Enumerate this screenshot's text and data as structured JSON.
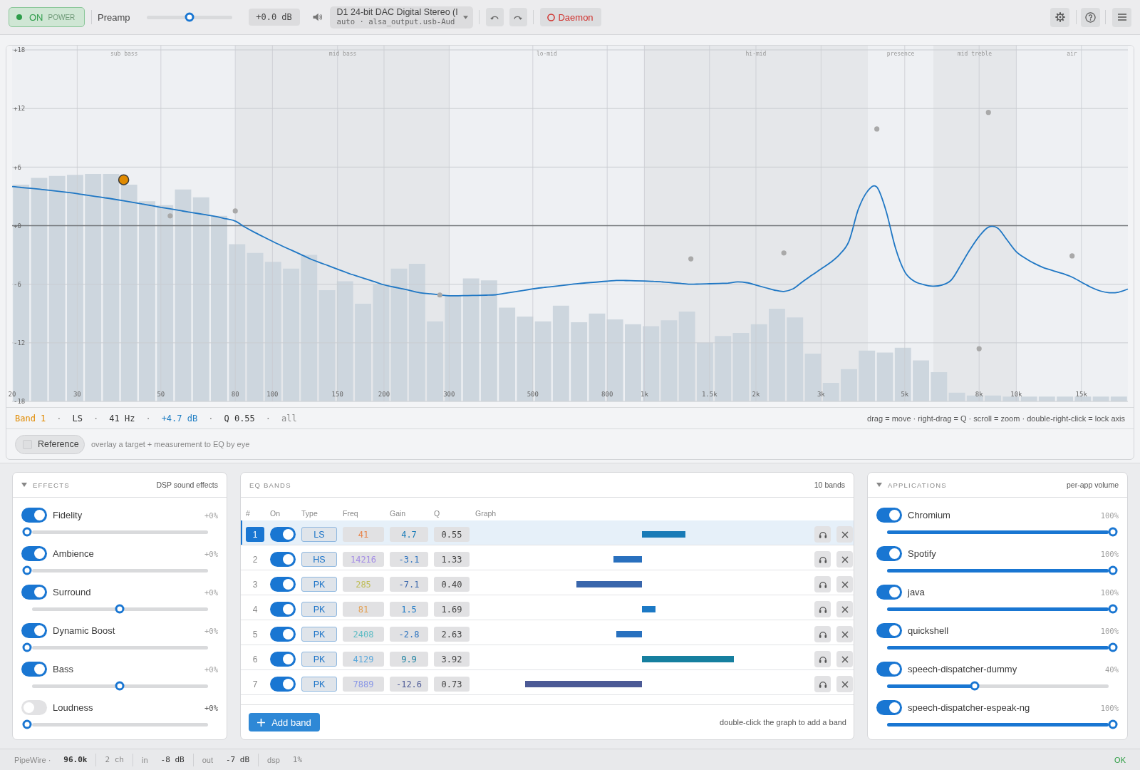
{
  "topbar": {
    "power": {
      "on": true,
      "label": "ON",
      "caption": "POWER"
    },
    "preamp": {
      "label": "Preamp",
      "level": 0.5,
      "reading": "+0.0 dB"
    },
    "device": {
      "name": "D1 24-bit DAC Digital Stereo (I",
      "detail": "auto · alsa_output.usb-Aud"
    },
    "daemon": {
      "label": "Daemon",
      "running": false
    }
  },
  "graph": {
    "zones": [
      "sub bass",
      "mid bass",
      "lo-mid",
      "hi-mid",
      "presence",
      "mid treble",
      "air"
    ],
    "chart_data": {
      "type": "line",
      "grid": true,
      "ylim": [
        -18,
        18
      ],
      "yticks": [
        {
          "value": 18,
          "label": "+18"
        },
        {
          "value": 12,
          "label": "+12"
        },
        {
          "value": 6,
          "label": "+6"
        },
        {
          "value": 0,
          "label": "+0"
        },
        {
          "value": -6,
          "label": "-6"
        },
        {
          "value": -12,
          "label": "-12"
        },
        {
          "value": -18,
          "label": "-18"
        }
      ],
      "categories": [
        "20",
        null,
        null,
        null,
        null,
        null,
        null,
        "30",
        null,
        null,
        null,
        null,
        null,
        null,
        null,
        null,
        "50",
        null,
        null,
        null,
        null,
        null,
        null,
        null,
        "80",
        null,
        null,
        null,
        "100",
        null,
        null,
        null,
        null,
        null,
        null,
        "150",
        null,
        null,
        null,
        null,
        "200",
        null,
        null,
        null,
        null,
        null,
        null,
        "300",
        null,
        null,
        null,
        null,
        null,
        null,
        null,
        null,
        "500",
        null,
        null,
        null,
        null,
        null,
        null,
        null,
        "800",
        null,
        null,
        null,
        "1k",
        null,
        null,
        null,
        null,
        null,
        null,
        "1.5k",
        null,
        null,
        null,
        null,
        "2k",
        null,
        null,
        null,
        null,
        null,
        null,
        "3k",
        null,
        null,
        null,
        null,
        null,
        null,
        null,
        null,
        "5k",
        null,
        null,
        null,
        null,
        null,
        null,
        null,
        "8k",
        null,
        null,
        null,
        "10k",
        null,
        null,
        null,
        null,
        null,
        null,
        "15k",
        null,
        null,
        null,
        null,
        null
      ],
      "series": [
        {
          "color": "#1f77c4",
          "values": [
            4.0,
            3.91,
            3.82,
            3.73,
            3.63,
            3.52,
            3.41,
            3.28,
            3.13,
            2.99,
            2.85,
            2.7,
            2.55,
            2.39,
            2.22,
            2.05,
            1.88,
            1.72,
            1.56,
            1.4,
            1.24,
            1.08,
            0.92,
            0.7,
            0.47,
            -0.13,
            -0.65,
            -1.13,
            -1.61,
            -2.06,
            -2.5,
            -2.93,
            -3.37,
            -3.75,
            -4.1,
            -4.46,
            -4.82,
            -5.14,
            -5.45,
            -5.75,
            -6.06,
            -6.28,
            -6.48,
            -6.69,
            -6.89,
            -6.99,
            -7.09,
            -7.18,
            -7.18,
            -7.16,
            -7.14,
            -7.12,
            -7.08,
            -6.93,
            -6.78,
            -6.63,
            -6.48,
            -6.35,
            -6.25,
            -6.14,
            -6.03,
            -5.93,
            -5.84,
            -5.77,
            -5.69,
            -5.61,
            -5.62,
            -5.65,
            -5.67,
            -5.7,
            -5.77,
            -5.85,
            -5.92,
            -6.0,
            -5.97,
            -5.95,
            -5.92,
            -5.89,
            -5.76,
            -5.84,
            -6.09,
            -6.35,
            -6.61,
            -6.74,
            -6.46,
            -5.75,
            -5.08,
            -4.44,
            -3.78,
            -2.94,
            -1.6,
            1.65,
            3.53,
            3.95,
            1.48,
            -2.28,
            -4.72,
            -5.68,
            -6.03,
            -6.2,
            -6.09,
            -5.58,
            -4.08,
            -2.49,
            -1.1,
            -0.15,
            -0.25,
            -1.46,
            -2.67,
            -3.35,
            -3.9,
            -4.33,
            -4.62,
            -4.91,
            -5.27,
            -5.78,
            -6.3,
            -6.68,
            -6.87,
            -6.81,
            -6.5
          ]
        },
        {
          "color": "#e08a00",
          "marker": "o",
          "values": [
            null,
            null,
            null,
            null,
            null,
            null,
            null,
            null,
            null,
            null,
            null,
            null,
            4.7,
            null,
            null,
            null,
            null,
            null,
            null,
            null,
            null,
            null,
            null,
            null,
            null,
            null,
            null,
            null,
            null,
            null,
            null,
            null,
            null,
            null,
            null,
            null,
            null,
            null,
            null,
            null,
            null,
            null,
            null,
            null,
            null,
            null,
            null,
            null,
            null,
            null,
            null,
            null,
            null,
            null,
            null,
            null,
            null,
            null,
            null,
            null,
            null,
            null,
            null,
            null,
            null,
            null,
            null,
            null,
            null,
            null,
            null,
            null,
            null,
            null,
            null,
            null,
            null,
            null,
            null,
            null,
            null,
            null,
            null,
            null,
            null,
            null,
            null,
            null,
            null,
            null,
            null,
            null,
            null,
            null,
            null,
            null,
            null,
            null,
            null,
            null,
            null,
            null,
            null,
            null,
            null,
            null,
            null,
            null,
            null,
            null,
            null,
            null,
            null,
            null,
            null,
            null,
            null,
            null,
            null,
            null,
            null
          ]
        },
        {
          "color": "#a9a9a9",
          "marker": "o",
          "values": [
            null,
            null,
            null,
            null,
            null,
            null,
            null,
            null,
            null,
            null,
            null,
            null,
            null,
            null,
            null,
            null,
            null,
            null,
            null,
            null,
            null,
            null,
            null,
            null,
            null,
            null,
            null,
            null,
            null,
            null,
            null,
            null,
            null,
            null,
            null,
            null,
            null,
            null,
            null,
            null,
            null,
            null,
            null,
            null,
            null,
            null,
            null,
            null,
            null,
            null,
            null,
            null,
            null,
            null,
            null,
            null,
            null,
            null,
            null,
            null,
            null,
            null,
            null,
            null,
            null,
            null,
            null,
            null,
            null,
            null,
            null,
            null,
            null,
            null,
            null,
            null,
            null,
            null,
            null,
            null,
            null,
            null,
            null,
            null,
            null,
            null,
            null,
            null,
            null,
            null,
            null,
            null,
            null,
            null,
            null,
            null,
            null,
            null,
            null,
            null,
            null,
            null,
            null,
            null,
            null,
            null,
            null,
            null,
            null,
            null,
            null,
            null,
            null,
            null,
            -3.1,
            null,
            null,
            null,
            null,
            null,
            null
          ]
        },
        {
          "color": "#a9a9a9",
          "marker": "o",
          "values": [
            null,
            null,
            null,
            null,
            null,
            null,
            null,
            null,
            null,
            null,
            null,
            null,
            null,
            null,
            null,
            null,
            null,
            null,
            null,
            null,
            null,
            null,
            null,
            null,
            null,
            null,
            null,
            null,
            null,
            null,
            null,
            null,
            null,
            null,
            null,
            null,
            null,
            null,
            null,
            null,
            null,
            null,
            null,
            null,
            null,
            null,
            -7.1,
            null,
            null,
            null,
            null,
            null,
            null,
            null,
            null,
            null,
            null,
            null,
            null,
            null,
            null,
            null,
            null,
            null,
            null,
            null,
            null,
            null,
            null,
            null,
            null,
            null,
            null,
            null,
            null,
            null,
            null,
            null,
            null,
            null,
            null,
            null,
            null,
            null,
            null,
            null,
            null,
            null,
            null,
            null,
            null,
            null,
            null,
            null,
            null,
            null,
            null,
            null,
            null,
            null,
            null,
            null,
            null,
            null,
            null,
            null,
            null,
            null,
            null,
            null,
            null,
            null,
            null,
            null,
            null,
            null,
            null,
            null,
            null,
            null,
            null
          ]
        },
        {
          "color": "#a9a9a9",
          "marker": "o",
          "values": [
            null,
            null,
            null,
            null,
            null,
            null,
            null,
            null,
            null,
            null,
            null,
            null,
            null,
            null,
            null,
            null,
            null,
            null,
            null,
            null,
            null,
            null,
            null,
            null,
            1.5,
            null,
            null,
            null,
            null,
            null,
            null,
            null,
            null,
            null,
            null,
            null,
            null,
            null,
            null,
            null,
            null,
            null,
            null,
            null,
            null,
            null,
            null,
            null,
            null,
            null,
            null,
            null,
            null,
            null,
            null,
            null,
            null,
            null,
            null,
            null,
            null,
            null,
            null,
            null,
            null,
            null,
            null,
            null,
            null,
            null,
            null,
            null,
            null,
            null,
            null,
            null,
            null,
            null,
            null,
            null,
            null,
            null,
            null,
            null,
            null,
            null,
            null,
            null,
            null,
            null,
            null,
            null,
            null,
            null,
            null,
            null,
            null,
            null,
            null,
            null,
            null,
            null,
            null,
            null,
            null,
            null,
            null,
            null,
            null,
            null,
            null,
            null,
            null,
            null,
            null,
            null,
            null,
            null,
            null,
            null,
            null
          ]
        },
        {
          "color": "#a9a9a9",
          "marker": "o",
          "values": [
            null,
            null,
            null,
            null,
            null,
            null,
            null,
            null,
            null,
            null,
            null,
            null,
            null,
            null,
            null,
            null,
            null,
            null,
            null,
            null,
            null,
            null,
            null,
            null,
            null,
            null,
            null,
            null,
            null,
            null,
            null,
            null,
            null,
            null,
            null,
            null,
            null,
            null,
            null,
            null,
            null,
            null,
            null,
            null,
            null,
            null,
            null,
            null,
            null,
            null,
            null,
            null,
            null,
            null,
            null,
            null,
            null,
            null,
            null,
            null,
            null,
            null,
            null,
            null,
            null,
            null,
            null,
            null,
            null,
            null,
            null,
            null,
            null,
            null,
            null,
            null,
            null,
            null,
            null,
            null,
            null,
            null,
            null,
            -2.8,
            null,
            null,
            null,
            null,
            null,
            null,
            null,
            null,
            null,
            null,
            null,
            null,
            null,
            null,
            null,
            null,
            null,
            null,
            null,
            null,
            null,
            null,
            null,
            null,
            null,
            null,
            null,
            null,
            null,
            null,
            null,
            null,
            null,
            null,
            null,
            null,
            null
          ]
        },
        {
          "color": "#a9a9a9",
          "marker": "o",
          "values": [
            null,
            null,
            null,
            null,
            null,
            null,
            null,
            null,
            null,
            null,
            null,
            null,
            null,
            null,
            null,
            null,
            null,
            null,
            null,
            null,
            null,
            null,
            null,
            null,
            null,
            null,
            null,
            null,
            null,
            null,
            null,
            null,
            null,
            null,
            null,
            null,
            null,
            null,
            null,
            null,
            null,
            null,
            null,
            null,
            null,
            null,
            null,
            null,
            null,
            null,
            null,
            null,
            null,
            null,
            null,
            null,
            null,
            null,
            null,
            null,
            null,
            null,
            null,
            null,
            null,
            null,
            null,
            null,
            null,
            null,
            null,
            null,
            null,
            null,
            null,
            null,
            null,
            null,
            null,
            null,
            null,
            null,
            null,
            null,
            null,
            null,
            null,
            null,
            null,
            null,
            null,
            null,
            null,
            9.9,
            null,
            null,
            null,
            null,
            null,
            null,
            null,
            null,
            null,
            null,
            null,
            null,
            null,
            null,
            null,
            null,
            null,
            null,
            null,
            null,
            null,
            null,
            null,
            null,
            null,
            null,
            null
          ]
        },
        {
          "color": "#a9a9a9",
          "marker": "o",
          "values": [
            null,
            null,
            null,
            null,
            null,
            null,
            null,
            null,
            null,
            null,
            null,
            null,
            null,
            null,
            null,
            null,
            null,
            null,
            null,
            null,
            null,
            null,
            null,
            null,
            null,
            null,
            null,
            null,
            null,
            null,
            null,
            null,
            null,
            null,
            null,
            null,
            null,
            null,
            null,
            null,
            null,
            null,
            null,
            null,
            null,
            null,
            null,
            null,
            null,
            null,
            null,
            null,
            null,
            null,
            null,
            null,
            null,
            null,
            null,
            null,
            null,
            null,
            null,
            null,
            null,
            null,
            null,
            null,
            null,
            null,
            null,
            null,
            null,
            null,
            null,
            null,
            null,
            null,
            null,
            null,
            null,
            null,
            null,
            null,
            null,
            null,
            null,
            null,
            null,
            null,
            null,
            null,
            null,
            null,
            null,
            null,
            null,
            null,
            null,
            null,
            null,
            null,
            null,
            null,
            -12.6,
            null,
            null,
            null,
            null,
            null,
            null,
            null,
            null,
            null,
            null,
            null,
            null,
            null,
            null,
            null,
            null
          ]
        },
        {
          "color": "#a9a9a9",
          "marker": "o",
          "values": [
            null,
            null,
            null,
            null,
            null,
            null,
            null,
            null,
            null,
            null,
            null,
            null,
            null,
            null,
            null,
            null,
            null,
            1.0,
            null,
            null,
            null,
            null,
            null,
            null,
            null,
            null,
            null,
            null,
            null,
            null,
            null,
            null,
            null,
            null,
            null,
            null,
            null,
            null,
            null,
            null,
            null,
            null,
            null,
            null,
            null,
            null,
            null,
            null,
            null,
            null,
            null,
            null,
            null,
            null,
            null,
            null,
            null,
            null,
            null,
            null,
            null,
            null,
            null,
            null,
            null,
            null,
            null,
            null,
            null,
            null,
            null,
            null,
            null,
            null,
            null,
            null,
            null,
            null,
            null,
            null,
            null,
            null,
            null,
            null,
            null,
            null,
            null,
            null,
            null,
            null,
            null,
            null,
            null,
            null,
            null,
            null,
            null,
            null,
            null,
            null,
            null,
            null,
            null,
            null,
            null,
            null,
            null,
            null,
            null,
            null,
            null,
            null,
            null,
            null,
            null,
            null,
            null,
            null,
            null,
            null,
            null
          ]
        },
        {
          "color": "#a9a9a9",
          "marker": "o",
          "values": [
            null,
            null,
            null,
            null,
            null,
            null,
            null,
            null,
            null,
            null,
            null,
            null,
            null,
            null,
            null,
            null,
            null,
            null,
            null,
            null,
            null,
            null,
            null,
            null,
            null,
            null,
            null,
            null,
            null,
            null,
            null,
            null,
            null,
            null,
            null,
            null,
            null,
            null,
            null,
            null,
            null,
            null,
            null,
            null,
            null,
            null,
            null,
            null,
            null,
            null,
            null,
            null,
            null,
            null,
            null,
            null,
            null,
            null,
            null,
            null,
            null,
            null,
            null,
            null,
            null,
            null,
            null,
            null,
            null,
            null,
            null,
            null,
            null,
            -3.4,
            null,
            null,
            null,
            null,
            null,
            null,
            null,
            null,
            null,
            null,
            null,
            null,
            null,
            null,
            null,
            null,
            null,
            null,
            null,
            null,
            null,
            null,
            null,
            null,
            null,
            null,
            null,
            null,
            null,
            null,
            null,
            null,
            null,
            null,
            null,
            null,
            null,
            null,
            null,
            null,
            null,
            null,
            null,
            null,
            null,
            null,
            null
          ]
        },
        {
          "color": "#a9a9a9",
          "marker": "o",
          "values": [
            null,
            null,
            null,
            null,
            null,
            null,
            null,
            null,
            null,
            null,
            null,
            null,
            null,
            null,
            null,
            null,
            null,
            null,
            null,
            null,
            null,
            null,
            null,
            null,
            null,
            null,
            null,
            null,
            null,
            null,
            null,
            null,
            null,
            null,
            null,
            null,
            null,
            null,
            null,
            null,
            null,
            null,
            null,
            null,
            null,
            null,
            null,
            null,
            null,
            null,
            null,
            null,
            null,
            null,
            null,
            null,
            null,
            null,
            null,
            null,
            null,
            null,
            null,
            null,
            null,
            null,
            null,
            null,
            null,
            null,
            null,
            null,
            null,
            null,
            null,
            null,
            null,
            null,
            null,
            null,
            null,
            null,
            null,
            null,
            null,
            null,
            null,
            null,
            null,
            null,
            null,
            null,
            null,
            null,
            null,
            null,
            null,
            null,
            null,
            null,
            null,
            null,
            null,
            null,
            null,
            11.6,
            null,
            null,
            null,
            null,
            null,
            null,
            null,
            null,
            null,
            null,
            null,
            null,
            null,
            null,
            null
          ]
        }
      ]
    },
    "readout": {
      "separator": "·",
      "parts": [
        {
          "kind": "band",
          "text": "Band 1"
        },
        {
          "kind": "type",
          "text": "LS"
        },
        {
          "kind": "frequency",
          "text": "41 Hz"
        },
        {
          "kind": "gain",
          "text": "+4.7 dB"
        },
        {
          "kind": "q",
          "text": "Q 0.55"
        },
        {
          "kind": "channel",
          "text": "all"
        }
      ]
    },
    "hint": "drag = move · right-drag = Q · scroll = zoom · double-right-click = lock axis",
    "reference": {
      "label": "Reference",
      "checked": false,
      "hint": "overlay a target + measurement to EQ by eye"
    }
  },
  "effects": {
    "title": "EFFECTS",
    "subtitle": "DSP sound effects",
    "expanded": true,
    "items": [
      {
        "name": "Fidelity",
        "on": true,
        "value": "+0%",
        "level": 0
      },
      {
        "name": "Ambience",
        "on": true,
        "value": "+0%",
        "level": 0
      },
      {
        "name": "Surround",
        "on": true,
        "value": "+0%",
        "level": 0.5
      },
      {
        "name": "Dynamic Boost",
        "on": true,
        "value": "+0%",
        "level": 0
      },
      {
        "name": "Bass",
        "on": true,
        "value": "+0%",
        "level": 0.5
      },
      {
        "name": "Loudness",
        "on": false,
        "value": "+0%",
        "level": 0
      }
    ]
  },
  "eq_bands": {
    "title": "EQ BANDS",
    "count": "10 bands",
    "columns": [
      "#",
      "On",
      "Type",
      "Freq",
      "Gain",
      "Q",
      "Graph"
    ],
    "rows": [
      {
        "number": "1",
        "selected": true,
        "on": true,
        "type": "LS",
        "freq": "41",
        "color": "#e8844a",
        "gain": "4.7",
        "q": "0.55"
      },
      {
        "number": "2",
        "selected": false,
        "on": true,
        "type": "HS",
        "freq": "14216",
        "color": "#a48ce6",
        "gain": "-3.1",
        "q": "1.33"
      },
      {
        "number": "3",
        "selected": false,
        "on": true,
        "type": "PK",
        "freq": "285",
        "color": "#bfbd55",
        "gain": "-7.1",
        "q": "0.40"
      },
      {
        "number": "4",
        "selected": false,
        "on": true,
        "type": "PK",
        "freq": "81",
        "color": "#e4a052",
        "gain": "1.5",
        "q": "1.69"
      },
      {
        "number": "5",
        "selected": false,
        "on": true,
        "type": "PK",
        "freq": "2408",
        "color": "#5ebcc4",
        "gain": "-2.8",
        "q": "2.63"
      },
      {
        "number": "6",
        "selected": false,
        "on": true,
        "type": "PK",
        "freq": "4129",
        "color": "#5aa8dc",
        "gain": "9.9",
        "q": "3.92"
      },
      {
        "number": "7",
        "selected": false,
        "on": true,
        "type": "PK",
        "freq": "7889",
        "color": "#8896e6",
        "gain": "-12.6",
        "q": "0.73"
      }
    ],
    "add_button": "Add band",
    "hint": "double-click the graph to add a band"
  },
  "applications": {
    "title": "APPLICATIONS",
    "subtitle": "per-app volume",
    "expanded": true,
    "items": [
      {
        "name": "Chromium",
        "on": true,
        "value": "100%",
        "level": 1
      },
      {
        "name": "Spotify",
        "on": true,
        "value": "100%",
        "level": 1
      },
      {
        "name": "java",
        "on": true,
        "value": "100%",
        "level": 1
      },
      {
        "name": "quickshell",
        "on": true,
        "value": "100%",
        "level": 1
      },
      {
        "name": "speech-dispatcher-dummy",
        "on": true,
        "value": "40%",
        "level": 0.4
      },
      {
        "name": "speech-dispatcher-espeak-ng",
        "on": true,
        "value": "100%",
        "level": 1
      }
    ]
  },
  "status_bar": {
    "items": [
      {
        "kind": "rate",
        "label": "PipeWire ·",
        "value": "96.0k"
      },
      {
        "kind": "channels",
        "value": "2 ch"
      },
      {
        "kind": "level",
        "label": "in",
        "value": "-8 dB"
      },
      {
        "kind": "level",
        "label": "out",
        "value": "-7 dB"
      },
      {
        "kind": "load",
        "label": "dsp",
        "value": "1%"
      }
    ],
    "status": "OK"
  }
}
